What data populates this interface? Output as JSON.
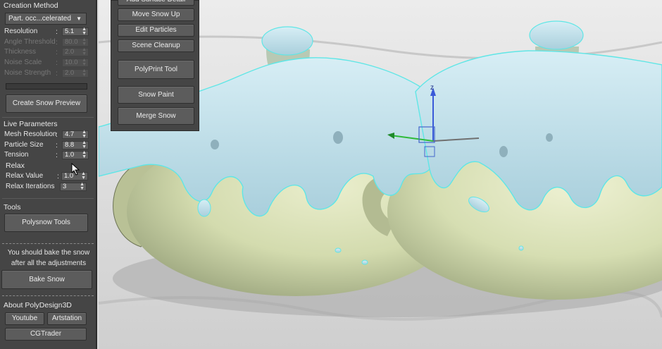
{
  "creation": {
    "title": "Creation Method",
    "method_value": "Part. occ...celerated",
    "resolution": {
      "label": "Resolution",
      "value": "5.1"
    },
    "angle_threshold": {
      "label": "Angle Threshold",
      "value": "80.0"
    },
    "thickness": {
      "label": "Thickness",
      "value": "2.0"
    },
    "noise_scale": {
      "label": "Noise Scale",
      "value": "10.0"
    },
    "noise_strength": {
      "label": "Noise Strength",
      "value": "2.0"
    },
    "preview_button": "Create Snow Preview"
  },
  "live": {
    "title": "Live Parameters",
    "mesh_resolution": {
      "label": "Mesh Resolution",
      "value": "4.7"
    },
    "particle_size": {
      "label": "Particle Size",
      "value": "8.8"
    },
    "tension": {
      "label": "Tension",
      "value": "1.0"
    },
    "relax_group": "Relax",
    "relax_value": {
      "label": "Relax Value",
      "value": "1.0"
    },
    "relax_iterations": {
      "label": "Relax Iterations",
      "value": "3"
    }
  },
  "tools": {
    "title": "Tools",
    "polysnow_button": "Polysnow Tools"
  },
  "bake": {
    "note_line1": "You should bake the snow",
    "note_line2": "after all the adjustments",
    "button": "Bake Snow"
  },
  "about": {
    "title": "About PolyDesign3D",
    "youtube": "Youtube",
    "artstation": "Artstation",
    "cgtrader": "CGTrader"
  },
  "float_panel": {
    "add_surface_detail": "Add Surface Detail",
    "move_snow_up": "Move Snow Up",
    "edit_particles": "Edit Particles",
    "scene_cleanup": "Scene Cleanup",
    "polyprint_tool": "PolyPrint Tool",
    "snow_paint": "Snow Paint",
    "merge_snow": "Merge Snow"
  },
  "gizmo": {
    "z_label": "z"
  },
  "colors": {
    "panel_bg": "#454545",
    "button_bg": "#5c5c5c",
    "snow": "#bcdde8",
    "teapot_body": "#d4dcb0",
    "selection_outline": "#5fe6e6"
  }
}
